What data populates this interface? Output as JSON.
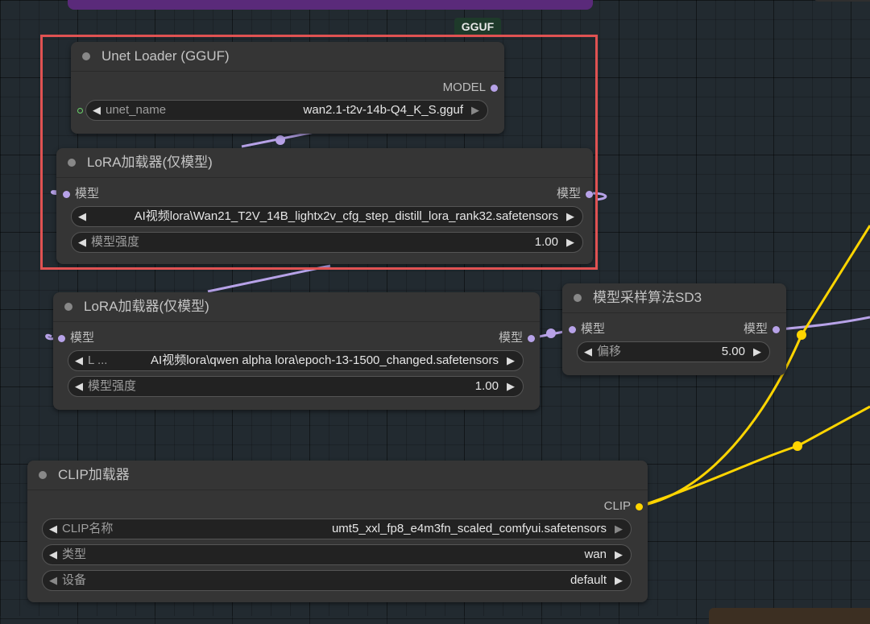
{
  "canvas": {
    "badge": "GGUF",
    "link_colors": {
      "model": "#b7a2e8",
      "clip": "#ffd500",
      "highlight": "#e05252"
    }
  },
  "nodes": {
    "unet_loader": {
      "title": "Unet Loader (GGUF)",
      "output_label": "MODEL",
      "widget": {
        "label": "unet_name",
        "value": "wan2.1-t2v-14b-Q4_K_S.gguf"
      }
    },
    "lora1": {
      "title": "LoRA加载器(仅模型)",
      "input_label": "模型",
      "output_label": "模型",
      "lora_widget": {
        "value": "AI视频lora\\Wan21_T2V_14B_lightx2v_cfg_step_distill_lora_rank32.safetensors"
      },
      "strength_widget": {
        "label": "模型强度",
        "value": "1.00"
      }
    },
    "lora2": {
      "title": "LoRA加载器(仅模型)",
      "input_label": "模型",
      "output_label": "模型",
      "lora_widget": {
        "label": "L ...",
        "value": "AI视频lora\\qwen alpha lora\\epoch-13-1500_changed.safetensors"
      },
      "strength_widget": {
        "label": "模型强度",
        "value": "1.00"
      }
    },
    "sampling_sd3": {
      "title": "模型采样算法SD3",
      "input_label": "模型",
      "output_label": "模型",
      "shift_widget": {
        "label": "偏移",
        "value": "5.00"
      }
    },
    "clip_loader": {
      "title": "CLIP加载器",
      "output_label": "CLIP",
      "widgets": [
        {
          "label": "CLIP名称",
          "value": "umt5_xxl_fp8_e4m3fn_scaled_comfyui.safetensors"
        },
        {
          "label": "类型",
          "value": "wan"
        },
        {
          "label": "设备",
          "value": "default"
        }
      ]
    }
  },
  "icons": {
    "arrow_left": "◀",
    "arrow_right": "▶",
    "title_dot": "circle-dot-icon",
    "slot_dot": "slot-dot-icon"
  }
}
